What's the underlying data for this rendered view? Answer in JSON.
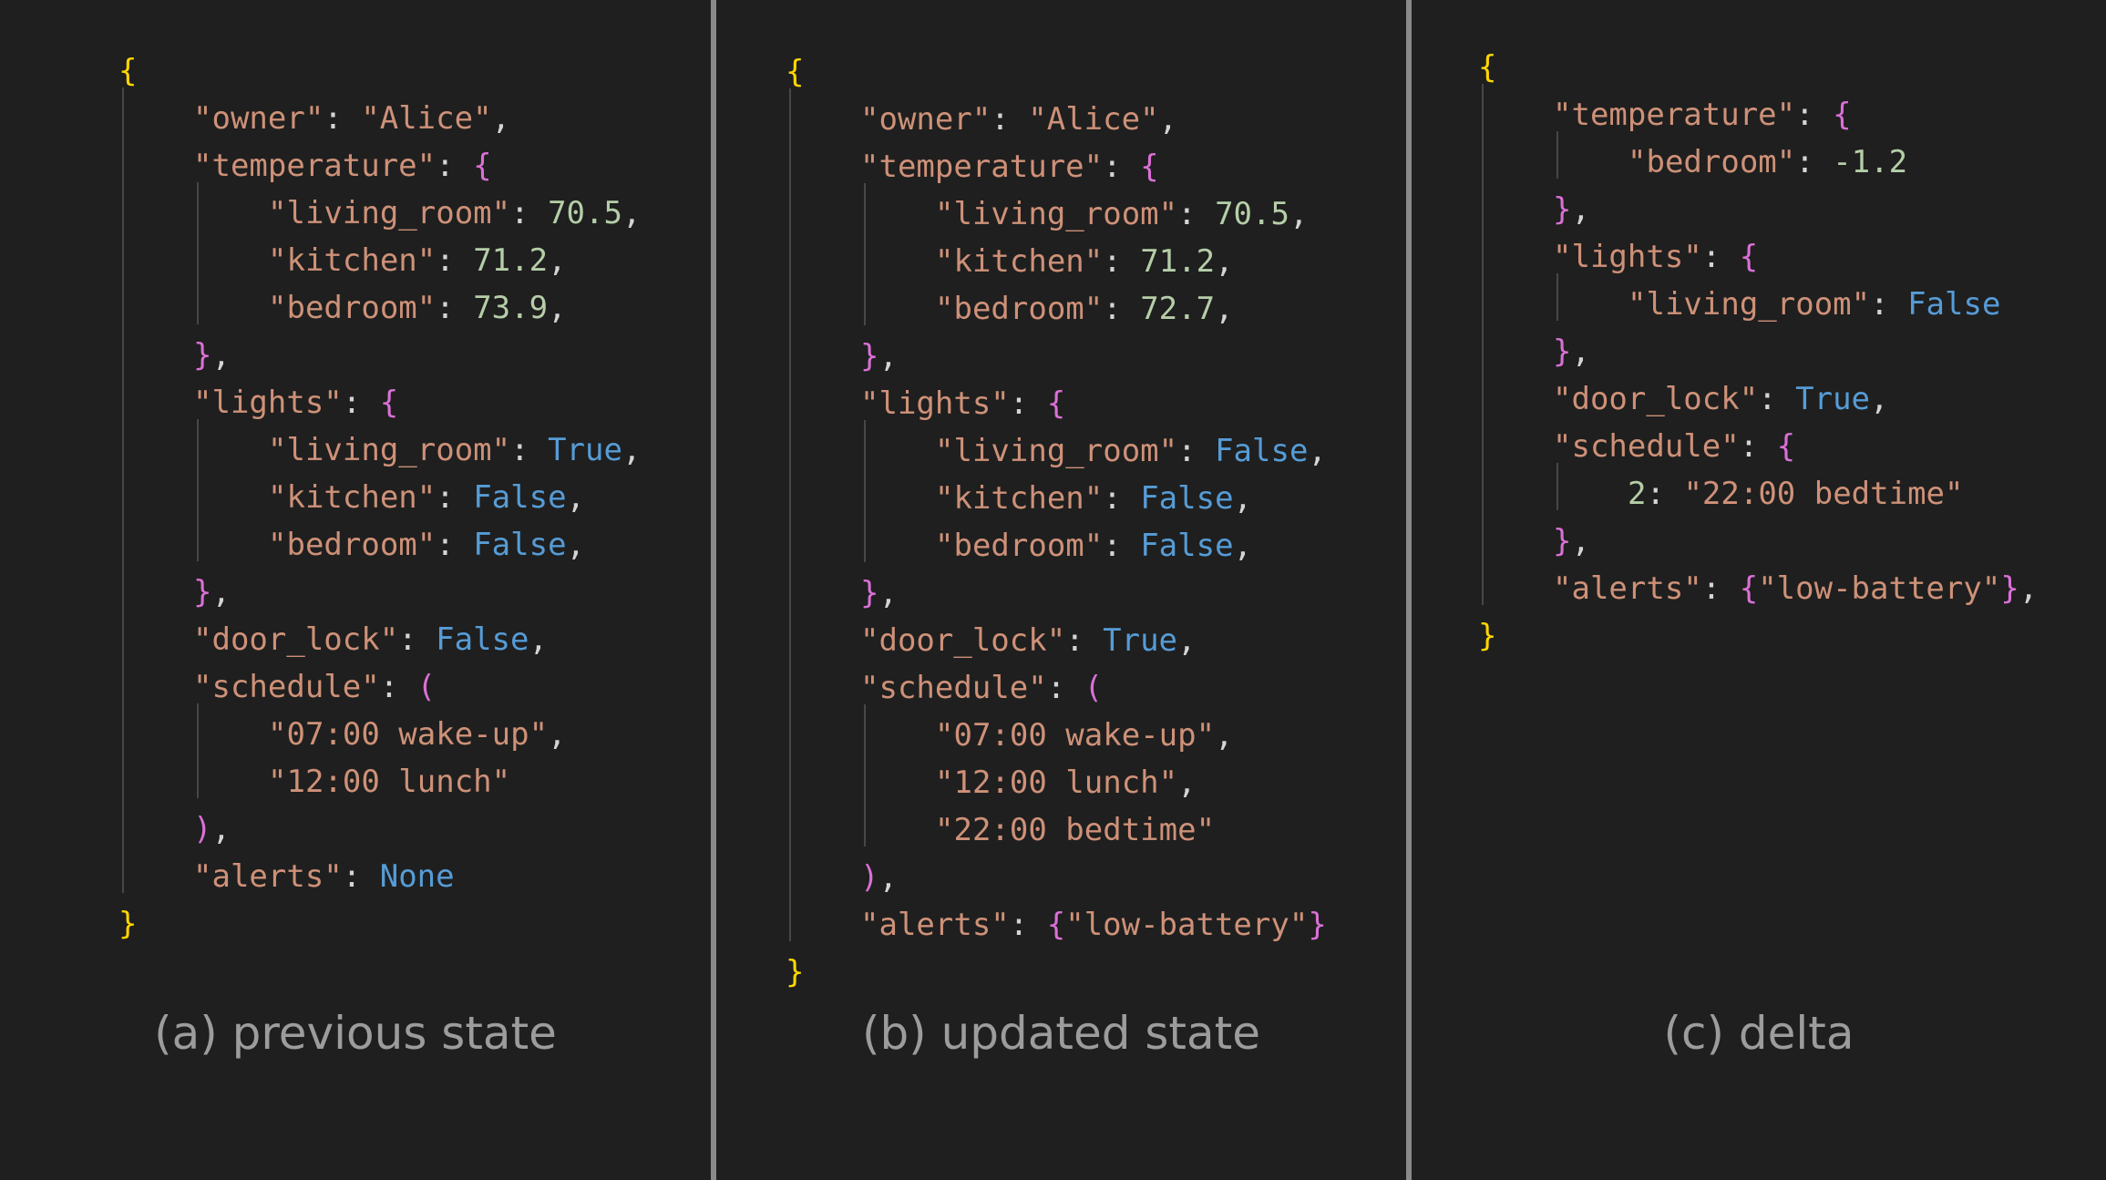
{
  "panels": [
    {
      "id": "a",
      "caption": "(a) previous state",
      "lines": [
        {
          "indent": 0,
          "tokens": [
            {
              "t": "{",
              "c": "b1"
            }
          ]
        },
        {
          "indent": 1,
          "tokens": [
            {
              "t": "\"owner\"",
              "c": "key"
            },
            {
              "t": ": ",
              "c": "p"
            },
            {
              "t": "\"Alice\"",
              "c": "str"
            },
            {
              "t": ",",
              "c": "p"
            }
          ]
        },
        {
          "indent": 1,
          "tokens": [
            {
              "t": "\"temperature\"",
              "c": "key"
            },
            {
              "t": ": ",
              "c": "p"
            },
            {
              "t": "{",
              "c": "b2"
            }
          ]
        },
        {
          "indent": 2,
          "tokens": [
            {
              "t": "\"living_room\"",
              "c": "key"
            },
            {
              "t": ": ",
              "c": "p"
            },
            {
              "t": "70.5",
              "c": "num"
            },
            {
              "t": ",",
              "c": "p"
            }
          ]
        },
        {
          "indent": 2,
          "tokens": [
            {
              "t": "\"kitchen\"",
              "c": "key"
            },
            {
              "t": ": ",
              "c": "p"
            },
            {
              "t": "71.2",
              "c": "num"
            },
            {
              "t": ",",
              "c": "p"
            }
          ]
        },
        {
          "indent": 2,
          "tokens": [
            {
              "t": "\"bedroom\"",
              "c": "key"
            },
            {
              "t": ": ",
              "c": "p"
            },
            {
              "t": "73.9",
              "c": "num"
            },
            {
              "t": ",",
              "c": "p"
            }
          ]
        },
        {
          "indent": 1,
          "tokens": [
            {
              "t": "}",
              "c": "b2"
            },
            {
              "t": ",",
              "c": "p"
            }
          ]
        },
        {
          "indent": 1,
          "tokens": [
            {
              "t": "\"lights\"",
              "c": "key"
            },
            {
              "t": ": ",
              "c": "p"
            },
            {
              "t": "{",
              "c": "b2"
            }
          ]
        },
        {
          "indent": 2,
          "tokens": [
            {
              "t": "\"living_room\"",
              "c": "key"
            },
            {
              "t": ": ",
              "c": "p"
            },
            {
              "t": "True",
              "c": "kw"
            },
            {
              "t": ",",
              "c": "p"
            }
          ]
        },
        {
          "indent": 2,
          "tokens": [
            {
              "t": "\"kitchen\"",
              "c": "key"
            },
            {
              "t": ": ",
              "c": "p"
            },
            {
              "t": "False",
              "c": "kw"
            },
            {
              "t": ",",
              "c": "p"
            }
          ]
        },
        {
          "indent": 2,
          "tokens": [
            {
              "t": "\"bedroom\"",
              "c": "key"
            },
            {
              "t": ": ",
              "c": "p"
            },
            {
              "t": "False",
              "c": "kw"
            },
            {
              "t": ",",
              "c": "p"
            }
          ]
        },
        {
          "indent": 1,
          "tokens": [
            {
              "t": "}",
              "c": "b2"
            },
            {
              "t": ",",
              "c": "p"
            }
          ]
        },
        {
          "indent": 1,
          "tokens": [
            {
              "t": "\"door_lock\"",
              "c": "key"
            },
            {
              "t": ": ",
              "c": "p"
            },
            {
              "t": "False",
              "c": "kw"
            },
            {
              "t": ",",
              "c": "p"
            }
          ]
        },
        {
          "indent": 1,
          "tokens": [
            {
              "t": "\"schedule\"",
              "c": "key"
            },
            {
              "t": ": ",
              "c": "p"
            },
            {
              "t": "(",
              "c": "b2"
            }
          ]
        },
        {
          "indent": 2,
          "tokens": [
            {
              "t": "\"07:00 wake-up\"",
              "c": "str"
            },
            {
              "t": ",",
              "c": "p"
            }
          ]
        },
        {
          "indent": 2,
          "tokens": [
            {
              "t": "\"12:00 lunch\"",
              "c": "str"
            }
          ]
        },
        {
          "indent": 1,
          "tokens": [
            {
              "t": ")",
              "c": "b2"
            },
            {
              "t": ",",
              "c": "p"
            }
          ]
        },
        {
          "indent": 1,
          "tokens": [
            {
              "t": "\"alerts\"",
              "c": "key"
            },
            {
              "t": ": ",
              "c": "p"
            },
            {
              "t": "None",
              "c": "kw"
            }
          ]
        },
        {
          "indent": 0,
          "tokens": [
            {
              "t": "}",
              "c": "b1"
            }
          ]
        }
      ]
    },
    {
      "id": "b",
      "caption": "(b) updated state",
      "lines": [
        {
          "indent": 0,
          "tokens": [
            {
              "t": "{",
              "c": "b1"
            }
          ]
        },
        {
          "indent": 1,
          "tokens": [
            {
              "t": "\"owner\"",
              "c": "key"
            },
            {
              "t": ": ",
              "c": "p"
            },
            {
              "t": "\"Alice\"",
              "c": "str"
            },
            {
              "t": ",",
              "c": "p"
            }
          ]
        },
        {
          "indent": 1,
          "tokens": [
            {
              "t": "\"temperature\"",
              "c": "key"
            },
            {
              "t": ": ",
              "c": "p"
            },
            {
              "t": "{",
              "c": "b2"
            }
          ]
        },
        {
          "indent": 2,
          "tokens": [
            {
              "t": "\"living_room\"",
              "c": "key"
            },
            {
              "t": ": ",
              "c": "p"
            },
            {
              "t": "70.5",
              "c": "num"
            },
            {
              "t": ",",
              "c": "p"
            }
          ]
        },
        {
          "indent": 2,
          "tokens": [
            {
              "t": "\"kitchen\"",
              "c": "key"
            },
            {
              "t": ": ",
              "c": "p"
            },
            {
              "t": "71.2",
              "c": "num"
            },
            {
              "t": ",",
              "c": "p"
            }
          ]
        },
        {
          "indent": 2,
          "tokens": [
            {
              "t": "\"bedroom\"",
              "c": "key"
            },
            {
              "t": ": ",
              "c": "p"
            },
            {
              "t": "72.7",
              "c": "num"
            },
            {
              "t": ",",
              "c": "p"
            }
          ]
        },
        {
          "indent": 1,
          "tokens": [
            {
              "t": "}",
              "c": "b2"
            },
            {
              "t": ",",
              "c": "p"
            }
          ]
        },
        {
          "indent": 1,
          "tokens": [
            {
              "t": "\"lights\"",
              "c": "key"
            },
            {
              "t": ": ",
              "c": "p"
            },
            {
              "t": "{",
              "c": "b2"
            }
          ]
        },
        {
          "indent": 2,
          "tokens": [
            {
              "t": "\"living_room\"",
              "c": "key"
            },
            {
              "t": ": ",
              "c": "p"
            },
            {
              "t": "False",
              "c": "kw"
            },
            {
              "t": ",",
              "c": "p"
            }
          ]
        },
        {
          "indent": 2,
          "tokens": [
            {
              "t": "\"kitchen\"",
              "c": "key"
            },
            {
              "t": ": ",
              "c": "p"
            },
            {
              "t": "False",
              "c": "kw"
            },
            {
              "t": ",",
              "c": "p"
            }
          ]
        },
        {
          "indent": 2,
          "tokens": [
            {
              "t": "\"bedroom\"",
              "c": "key"
            },
            {
              "t": ": ",
              "c": "p"
            },
            {
              "t": "False",
              "c": "kw"
            },
            {
              "t": ",",
              "c": "p"
            }
          ]
        },
        {
          "indent": 1,
          "tokens": [
            {
              "t": "}",
              "c": "b2"
            },
            {
              "t": ",",
              "c": "p"
            }
          ]
        },
        {
          "indent": 1,
          "tokens": [
            {
              "t": "\"door_lock\"",
              "c": "key"
            },
            {
              "t": ": ",
              "c": "p"
            },
            {
              "t": "True",
              "c": "kw"
            },
            {
              "t": ",",
              "c": "p"
            }
          ]
        },
        {
          "indent": 1,
          "tokens": [
            {
              "t": "\"schedule\"",
              "c": "key"
            },
            {
              "t": ": ",
              "c": "p"
            },
            {
              "t": "(",
              "c": "b2"
            }
          ]
        },
        {
          "indent": 2,
          "tokens": [
            {
              "t": "\"07:00 wake-up\"",
              "c": "str"
            },
            {
              "t": ",",
              "c": "p"
            }
          ]
        },
        {
          "indent": 2,
          "tokens": [
            {
              "t": "\"12:00 lunch\"",
              "c": "str"
            },
            {
              "t": ",",
              "c": "p"
            }
          ]
        },
        {
          "indent": 2,
          "tokens": [
            {
              "t": "\"22:00 bedtime\"",
              "c": "str"
            }
          ]
        },
        {
          "indent": 1,
          "tokens": [
            {
              "t": ")",
              "c": "b2"
            },
            {
              "t": ",",
              "c": "p"
            }
          ]
        },
        {
          "indent": 1,
          "tokens": [
            {
              "t": "\"alerts\"",
              "c": "key"
            },
            {
              "t": ": ",
              "c": "p"
            },
            {
              "t": "{",
              "c": "b2"
            },
            {
              "t": "\"low-battery\"",
              "c": "str"
            },
            {
              "t": "}",
              "c": "b2"
            }
          ]
        },
        {
          "indent": 0,
          "tokens": [
            {
              "t": "}",
              "c": "b1"
            }
          ]
        }
      ]
    },
    {
      "id": "c",
      "caption": "(c) delta",
      "lines": [
        {
          "indent": 0,
          "tokens": [
            {
              "t": "{",
              "c": "b1"
            }
          ]
        },
        {
          "indent": 1,
          "tokens": [
            {
              "t": "\"temperature\"",
              "c": "key"
            },
            {
              "t": ": ",
              "c": "p"
            },
            {
              "t": "{",
              "c": "b2"
            }
          ]
        },
        {
          "indent": 2,
          "tokens": [
            {
              "t": "\"bedroom\"",
              "c": "key"
            },
            {
              "t": ": ",
              "c": "p"
            },
            {
              "t": "-1.2",
              "c": "num"
            }
          ]
        },
        {
          "indent": 1,
          "tokens": [
            {
              "t": "}",
              "c": "b2"
            },
            {
              "t": ",",
              "c": "p"
            }
          ]
        },
        {
          "indent": 1,
          "tokens": [
            {
              "t": "\"lights\"",
              "c": "key"
            },
            {
              "t": ": ",
              "c": "p"
            },
            {
              "t": "{",
              "c": "b2"
            }
          ]
        },
        {
          "indent": 2,
          "tokens": [
            {
              "t": "\"living_room\"",
              "c": "key"
            },
            {
              "t": ": ",
              "c": "p"
            },
            {
              "t": "False",
              "c": "kw"
            }
          ]
        },
        {
          "indent": 1,
          "tokens": [
            {
              "t": "}",
              "c": "b2"
            },
            {
              "t": ",",
              "c": "p"
            }
          ]
        },
        {
          "indent": 1,
          "tokens": [
            {
              "t": "\"door_lock\"",
              "c": "key"
            },
            {
              "t": ": ",
              "c": "p"
            },
            {
              "t": "True",
              "c": "kw"
            },
            {
              "t": ",",
              "c": "p"
            }
          ]
        },
        {
          "indent": 1,
          "tokens": [
            {
              "t": "\"schedule\"",
              "c": "key"
            },
            {
              "t": ": ",
              "c": "p"
            },
            {
              "t": "{",
              "c": "b2"
            }
          ]
        },
        {
          "indent": 2,
          "tokens": [
            {
              "t": "2",
              "c": "num"
            },
            {
              "t": ": ",
              "c": "p"
            },
            {
              "t": "\"22:00 bedtime\"",
              "c": "str"
            }
          ]
        },
        {
          "indent": 1,
          "tokens": [
            {
              "t": "}",
              "c": "b2"
            },
            {
              "t": ",",
              "c": "p"
            }
          ]
        },
        {
          "indent": 1,
          "tokens": [
            {
              "t": "\"alerts\"",
              "c": "key"
            },
            {
              "t": ": ",
              "c": "p"
            },
            {
              "t": "{",
              "c": "b2"
            },
            {
              "t": "\"low-battery\"",
              "c": "str"
            },
            {
              "t": "}",
              "c": "b2"
            },
            {
              "t": ",",
              "c": "p"
            }
          ]
        },
        {
          "indent": 0,
          "tokens": [
            {
              "t": "}",
              "c": "b1"
            }
          ]
        }
      ]
    }
  ]
}
